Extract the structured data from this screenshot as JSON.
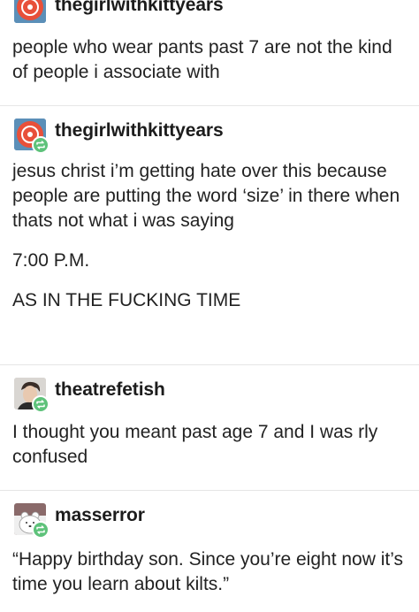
{
  "posts": [
    {
      "username": "thegirlwithkittyears",
      "avatar": "orange-circle-avatar",
      "reblog": false,
      "paragraphs": [
        "people who wear pants past 7 are not the kind of people i associate with"
      ]
    },
    {
      "username": "thegirlwithkittyears",
      "avatar": "orange-circle-avatar",
      "reblog": true,
      "paragraphs": [
        "jesus christ i’m getting hate over this because people are putting the word ‘size’ in there when thats not what i was saying",
        "7:00 P.M.",
        "AS IN THE FUCKING TIME"
      ]
    },
    {
      "username": "theatrefetish",
      "avatar": "photo-avatar",
      "reblog": true,
      "paragraphs": [
        "I thought you meant past age 7 and I was rly confused"
      ]
    },
    {
      "username": "masserror",
      "avatar": "cartoon-bear-avatar",
      "reblog": true,
      "paragraphs": [
        "“Happy birthday son. Since you’re eight now it’s time you learn about kilts.”"
      ]
    }
  ],
  "colors": {
    "avatar_orange": "#e8503a",
    "avatar_blue_bg": "#5b8fb8",
    "reblog_green": "#5ec27a",
    "divider": "#e6e6e6"
  }
}
